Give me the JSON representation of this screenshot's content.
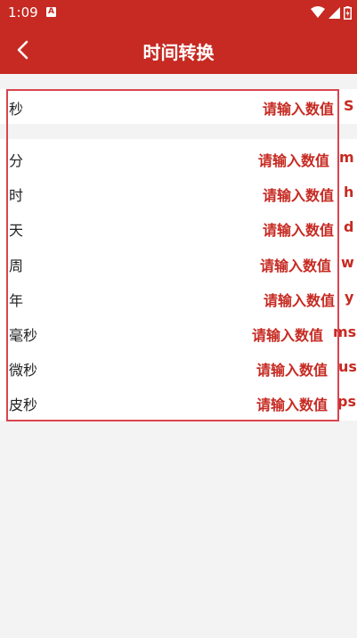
{
  "status": {
    "time": "1:09",
    "notification_letter": "A"
  },
  "toolbar": {
    "title": "时间转换"
  },
  "rows": [
    {
      "label": "秒",
      "placeholder": "请输入数值",
      "unit": "S"
    },
    {
      "label": "分",
      "placeholder": "请输入数值",
      "unit": "m"
    },
    {
      "label": "时",
      "placeholder": "请输入数值",
      "unit": "h"
    },
    {
      "label": "天",
      "placeholder": "请输入数值",
      "unit": "d"
    },
    {
      "label": "周",
      "placeholder": "请输入数值",
      "unit": "w"
    },
    {
      "label": "年",
      "placeholder": "请输入数值",
      "unit": "y"
    },
    {
      "label": "毫秒",
      "placeholder": "请输入数值",
      "unit": "ms"
    },
    {
      "label": "微秒",
      "placeholder": "请输入数值",
      "unit": "us"
    },
    {
      "label": "皮秒",
      "placeholder": "请输入数值",
      "unit": "ps"
    }
  ],
  "colors": {
    "accent": "#c62a22",
    "frame": "#d9444f"
  }
}
